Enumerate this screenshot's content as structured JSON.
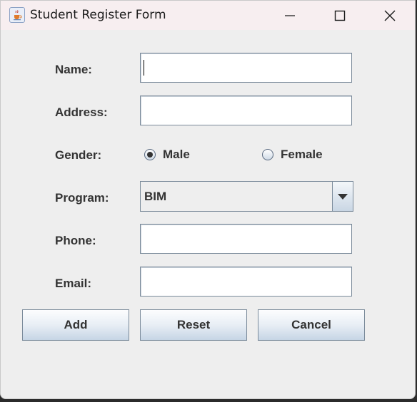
{
  "window": {
    "title": "Student Register Form",
    "icon": "java-cup-icon",
    "controls": [
      "minimize-icon",
      "maximize-icon",
      "close-icon"
    ]
  },
  "form": {
    "name": {
      "label": "Name:",
      "value": ""
    },
    "address": {
      "label": "Address:",
      "value": ""
    },
    "gender": {
      "label": "Gender:",
      "options": [
        {
          "label": "Male",
          "checked": true
        },
        {
          "label": "Female",
          "checked": false
        }
      ]
    },
    "program": {
      "label": "Program:",
      "selected": "BIM"
    },
    "phone": {
      "label": "Phone:",
      "value": ""
    },
    "email": {
      "label": "Email:",
      "value": ""
    }
  },
  "buttons": {
    "add": "Add",
    "reset": "Reset",
    "cancel": "Cancel"
  },
  "colors": {
    "titlebar": "#f7eef0",
    "background": "#eeeeee",
    "border": "#7a8a9a",
    "text": "#333333"
  }
}
